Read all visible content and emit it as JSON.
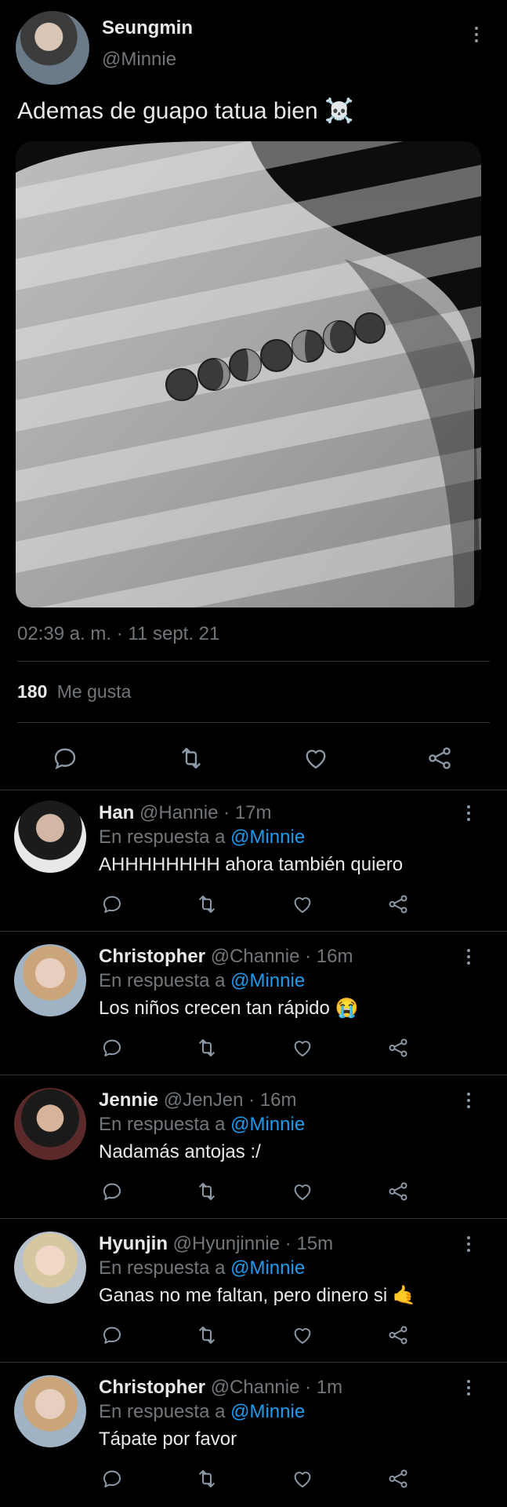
{
  "main_tweet": {
    "author_name": "Seungmin",
    "author_handle": "@Minnie",
    "text": "Ademas de guapo tatua bien ☠️",
    "timestamp": "02:39 a. m. · 11 sept. 21",
    "likes_count": "180",
    "likes_label": "Me gusta"
  },
  "replies": [
    {
      "name": "Han",
      "handle": "@Hannie",
      "time": "· 17m",
      "reply_prefix": "En respuesta a",
      "reply_to": "@Minnie",
      "text": "AHHHHHHHH ahora también quiero"
    },
    {
      "name": "Christopher",
      "handle": "@Channie",
      "time": "· 16m",
      "reply_prefix": "En respuesta a",
      "reply_to": "@Minnie",
      "text": "Los niños crecen tan rápido 😭"
    },
    {
      "name": "Jennie",
      "handle": "@JenJen",
      "time": "· 16m",
      "reply_prefix": "En respuesta a",
      "reply_to": "@Minnie",
      "text": "Nadamás antojas :/"
    },
    {
      "name": "Hyunjin",
      "handle": "@Hyunjinnie",
      "time": "· 15m",
      "reply_prefix": "En respuesta a",
      "reply_to": "@Minnie",
      "text": "Ganas no me faltan, pero dinero si 🤙"
    },
    {
      "name": "Christopher",
      "handle": "@Channie",
      "time": "· 1m",
      "reply_prefix": "En respuesta a",
      "reply_to": "@Minnie",
      "text": "Tápate por favor"
    }
  ],
  "icons": {
    "reply": "reply-icon",
    "retweet": "retweet-icon",
    "like": "heart-icon",
    "share": "share-icon",
    "more": "more-options-icon"
  }
}
